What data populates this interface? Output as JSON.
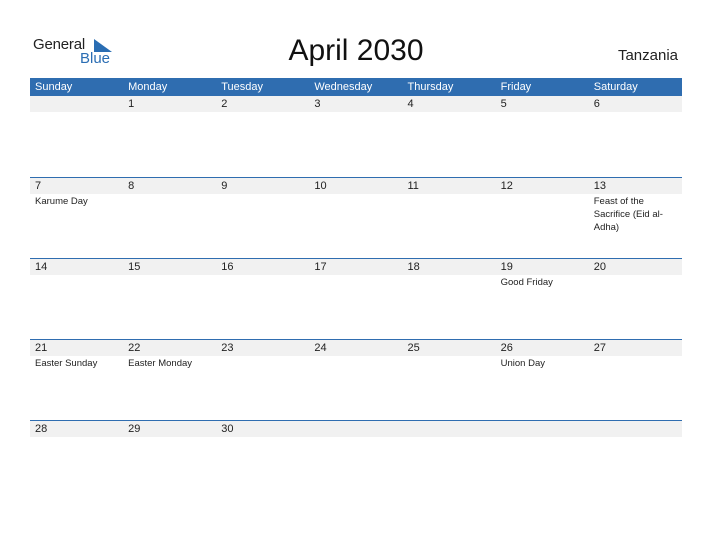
{
  "logo": {
    "general": "General",
    "blue": "Blue",
    "icon": "triangle-flag-icon"
  },
  "title": "April 2030",
  "country": "Tanzania",
  "colors": {
    "accent": "#2f6db0",
    "date_strip": "#f1f1f1",
    "logo_blue": "#2a6db3"
  },
  "weekdays": [
    "Sunday",
    "Monday",
    "Tuesday",
    "Wednesday",
    "Thursday",
    "Friday",
    "Saturday"
  ],
  "weeks": [
    {
      "days": [
        "",
        "1",
        "2",
        "3",
        "4",
        "5",
        "6"
      ],
      "events": [
        "",
        "",
        "",
        "",
        "",
        "",
        ""
      ]
    },
    {
      "days": [
        "7",
        "8",
        "9",
        "10",
        "11",
        "12",
        "13"
      ],
      "events": [
        "Karume Day",
        "",
        "",
        "",
        "",
        "",
        "Feast of the Sacrifice (Eid al-Adha)"
      ]
    },
    {
      "days": [
        "14",
        "15",
        "16",
        "17",
        "18",
        "19",
        "20"
      ],
      "events": [
        "",
        "",
        "",
        "",
        "",
        "Good Friday",
        ""
      ]
    },
    {
      "days": [
        "21",
        "22",
        "23",
        "24",
        "25",
        "26",
        "27"
      ],
      "events": [
        "Easter Sunday",
        "Easter Monday",
        "",
        "",
        "",
        "Union Day",
        ""
      ]
    },
    {
      "days": [
        "28",
        "29",
        "30",
        "",
        "",
        "",
        ""
      ],
      "events": [
        "",
        "",
        "",
        "",
        "",
        "",
        ""
      ]
    }
  ]
}
